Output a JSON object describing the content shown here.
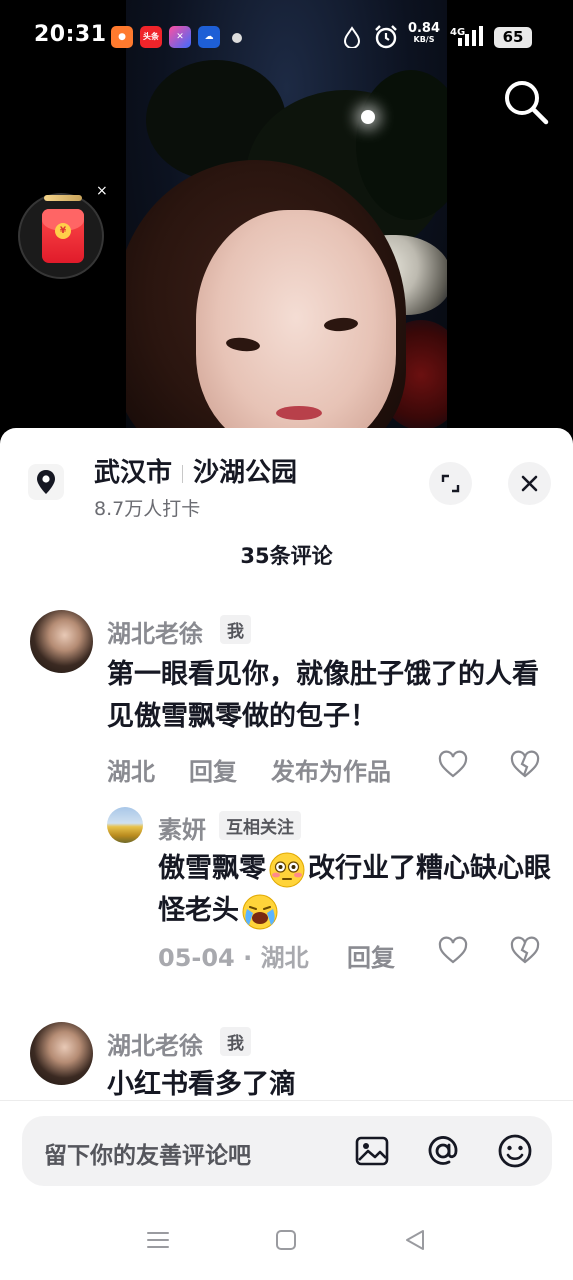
{
  "status_bar": {
    "time": "20:31",
    "apps": [
      {
        "name": "taobao-app-icon",
        "color": "#ff6a2a",
        "label": ""
      },
      {
        "name": "toutiao-app-icon",
        "color": "#f0242a",
        "label": "头条"
      },
      {
        "name": "tv-app-icon",
        "color": "#2f63ff",
        "label": ""
      },
      {
        "name": "weather-app-icon",
        "color": "#2a6fe0",
        "label": ""
      }
    ],
    "network_speed": "0.84",
    "network_speed_unit": "KB/S",
    "network_type": "4G",
    "battery": "65"
  },
  "red_packet": {
    "coin_symbol": "¥",
    "close_label": "×"
  },
  "location": {
    "city": "武汉市",
    "place": "沙湖公园",
    "checkins": "8.7万人打卡"
  },
  "comments_header": {
    "count_label": "35条评论"
  },
  "comments": [
    {
      "author": "湖北老徐",
      "tag": "我",
      "text": "第一眼看见你，就像肚子饿了的人看见傲雪飘零做的包子！",
      "region": "湖北",
      "reply_label": "回复",
      "publish_label": "发布为作品"
    },
    {
      "author": "素妍",
      "tag": "互相关注",
      "text_part1": "傲雪飘零",
      "text_part2": "改行业了糟心缺心眼怪老头",
      "emoji1": "flushed-emoji",
      "emoji2": "crying-emoji",
      "meta": "05-04 · 湖北",
      "reply_label": "回复"
    },
    {
      "author": "湖北老徐",
      "tag": "我",
      "text": "小红书看多了滴"
    }
  ],
  "input": {
    "placeholder": "留下你的友善评论吧"
  },
  "icons": {
    "heart": "heart-icon",
    "dislike": "broken-heart-icon",
    "image": "image-icon",
    "mention": "at-icon",
    "emoji": "emoji-icon"
  }
}
